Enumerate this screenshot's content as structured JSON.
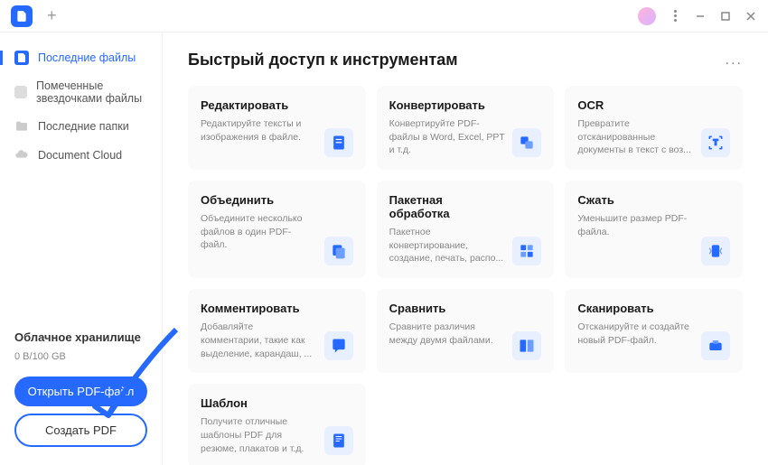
{
  "titlebar": {
    "new_tab": "+"
  },
  "sidebar": {
    "items": [
      {
        "label": "Последние файлы"
      },
      {
        "label": "Помеченные звездочками файлы"
      },
      {
        "label": "Последние папки"
      },
      {
        "label": "Document Cloud"
      }
    ],
    "storage": {
      "title": "Облачное хранилище",
      "info": "0 B/100 GB"
    },
    "open_btn": "Открыть PDF-файл",
    "create_btn": "Создать PDF"
  },
  "content": {
    "title": "Быстрый доступ к инструментам",
    "more": "...",
    "cards": [
      {
        "title": "Редактировать",
        "desc": "Редактируйте тексты и изображения в файле."
      },
      {
        "title": "Конвертировать",
        "desc": "Конвертируйте PDF-файлы в Word, Excel, PPT и т.д."
      },
      {
        "title": "OCR",
        "desc": "Превратите отсканированные документы в текст с воз..."
      },
      {
        "title": "Объединить",
        "desc": "Объедините несколько файлов в один PDF-файл."
      },
      {
        "title": "Пакетная обработка",
        "desc": "Пакетное конвертирование, создание, печать, распо..."
      },
      {
        "title": "Сжать",
        "desc": "Уменьшите размер PDF-файла."
      },
      {
        "title": "Комментировать",
        "desc": "Добавляйте комментарии, такие как выделение, карандаш, ..."
      },
      {
        "title": "Сравнить",
        "desc": "Сравните различия между двумя файлами."
      },
      {
        "title": "Сканировать",
        "desc": "Отсканируйте и создайте новый PDF-файл."
      },
      {
        "title": "Шаблон",
        "desc": "Получите отличные шаблоны PDF для резюме, плакатов и т.д."
      }
    ]
  }
}
